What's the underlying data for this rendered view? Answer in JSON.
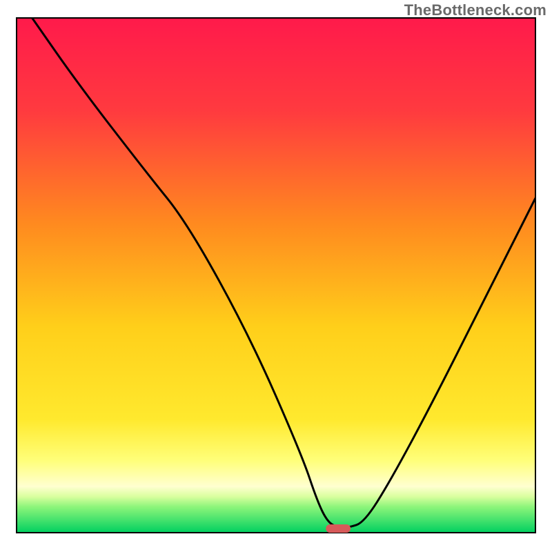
{
  "header": {
    "watermark": "TheBottleneck.com"
  },
  "chart_data": {
    "type": "line",
    "title": "",
    "xlabel": "",
    "ylabel": "",
    "xlim": [
      0,
      100
    ],
    "ylim": [
      0,
      100
    ],
    "background": {
      "gradient_top": "#ff1a4b",
      "gradient_mid": "#ffd400",
      "gradient_low": "#ffff66",
      "gradient_bottom": "#00d060"
    },
    "series": [
      {
        "name": "bottleneck-curve",
        "color": "#000000",
        "x": [
          3,
          12,
          25,
          33,
          45,
          55,
          58,
          60,
          62,
          64,
          67,
          72,
          80,
          90,
          100
        ],
        "y": [
          100,
          87,
          70,
          60,
          38,
          15,
          6,
          2,
          1,
          1,
          2,
          10,
          25,
          45,
          65
        ]
      }
    ],
    "marker": {
      "name": "optimal-marker",
      "x": 62,
      "y": 0.8,
      "color": "#d75a5a"
    }
  }
}
